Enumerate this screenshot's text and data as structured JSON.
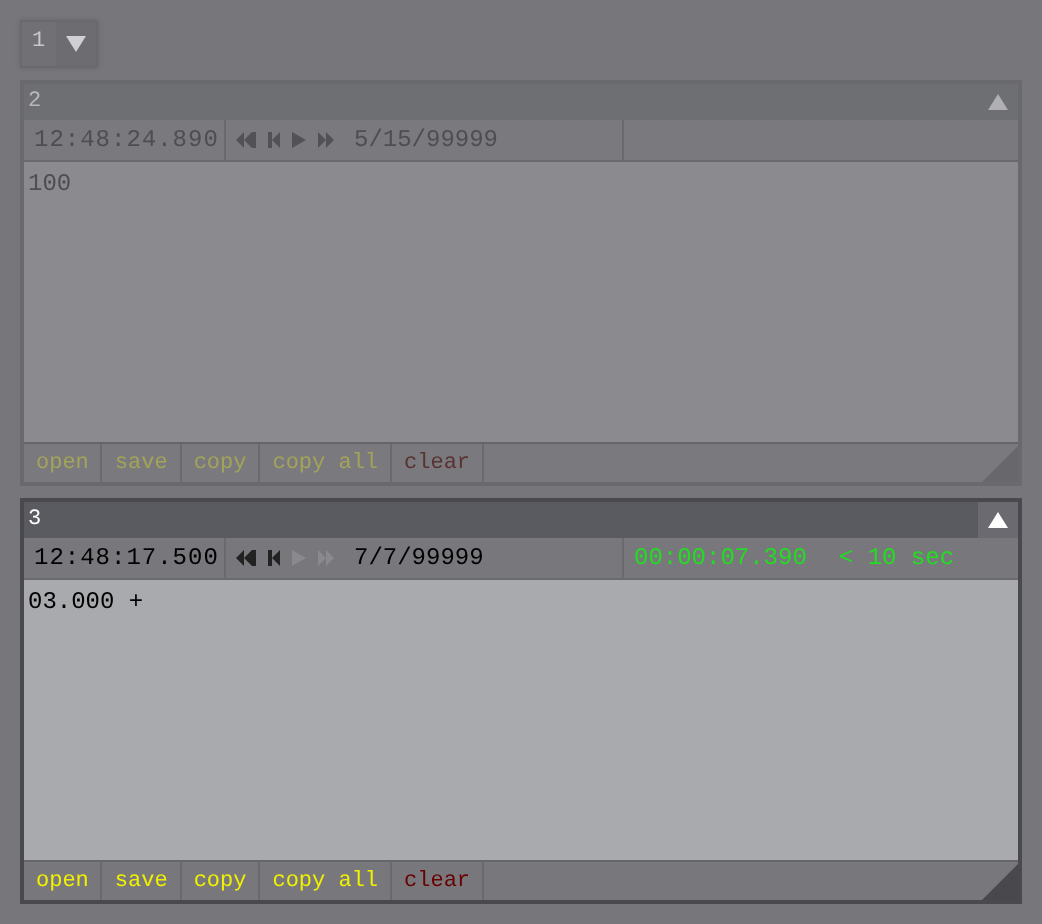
{
  "selector": {
    "value": "1"
  },
  "panels": [
    {
      "title": "2",
      "active": false,
      "time": "12:48:24.890",
      "transport": [
        {
          "kind": "first",
          "disabled": false
        },
        {
          "kind": "prev",
          "disabled": false
        },
        {
          "kind": "play",
          "disabled": false
        },
        {
          "kind": "last",
          "disabled": false
        }
      ],
      "date": "5/15/99999",
      "content": "100",
      "actions": [
        {
          "label": "open",
          "kind": "normal"
        },
        {
          "label": "save",
          "kind": "normal"
        },
        {
          "label": "copy",
          "kind": "normal"
        },
        {
          "label": "copy all",
          "kind": "normal"
        },
        {
          "label": "clear",
          "kind": "danger"
        }
      ]
    },
    {
      "title": "3",
      "active": true,
      "time": "12:48:17.500",
      "transport": [
        {
          "kind": "first",
          "disabled": false
        },
        {
          "kind": "prev",
          "disabled": false
        },
        {
          "kind": "play",
          "disabled": true
        },
        {
          "kind": "last",
          "disabled": true
        }
      ],
      "date": "7/7/99999",
      "timer": "00:00:07.390",
      "timer_note": "< 10 sec",
      "content": "03.000 +",
      "actions": [
        {
          "label": "open",
          "kind": "normal"
        },
        {
          "label": "save",
          "kind": "normal"
        },
        {
          "label": "copy",
          "kind": "normal"
        },
        {
          "label": "copy all",
          "kind": "normal"
        },
        {
          "label": "clear",
          "kind": "danger"
        }
      ]
    }
  ]
}
